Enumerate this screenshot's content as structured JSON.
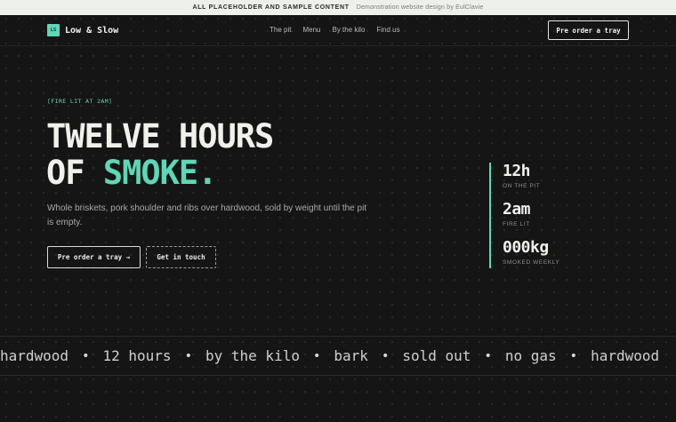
{
  "banner": {
    "primary": "ALL PLACEHOLDER AND SAMPLE CONTENT",
    "secondary": "Demonstration website design by EulClavie"
  },
  "nav": {
    "logo_badge": "LS",
    "brand": "Low & Slow",
    "links": [
      "The pit",
      "Menu",
      "By the kilo",
      "Find us"
    ],
    "cta": "Pre order a tray"
  },
  "hero": {
    "eyebrow": "[FIRE LIT AT 2AM]",
    "headline_line1": "TWELVE HOURS",
    "headline_line2_prefix": "OF ",
    "headline_accent": "SMOKE",
    "headline_period": ".",
    "lede": "Whole briskets, pork shoulder and ribs over hardwood, sold by weight until the pit is empty.",
    "primary_button": "Pre order a tray →",
    "secondary_button": "Get in touch"
  },
  "stats": [
    {
      "value": "12h",
      "label": "ON THE PIT"
    },
    {
      "value": "2am",
      "label": "FIRE LIT"
    },
    {
      "value": "000kg",
      "label": "SMOKED WEEKLY"
    }
  ],
  "ticker": {
    "items": [
      "hardwood",
      "12 hours",
      "by the kilo",
      "bark",
      "sold out",
      "no gas",
      "hardwood"
    ],
    "separator": "•"
  },
  "colors": {
    "accent": "#5fd6b6",
    "background": "#151515",
    "banner_bg": "#eef0ec"
  }
}
